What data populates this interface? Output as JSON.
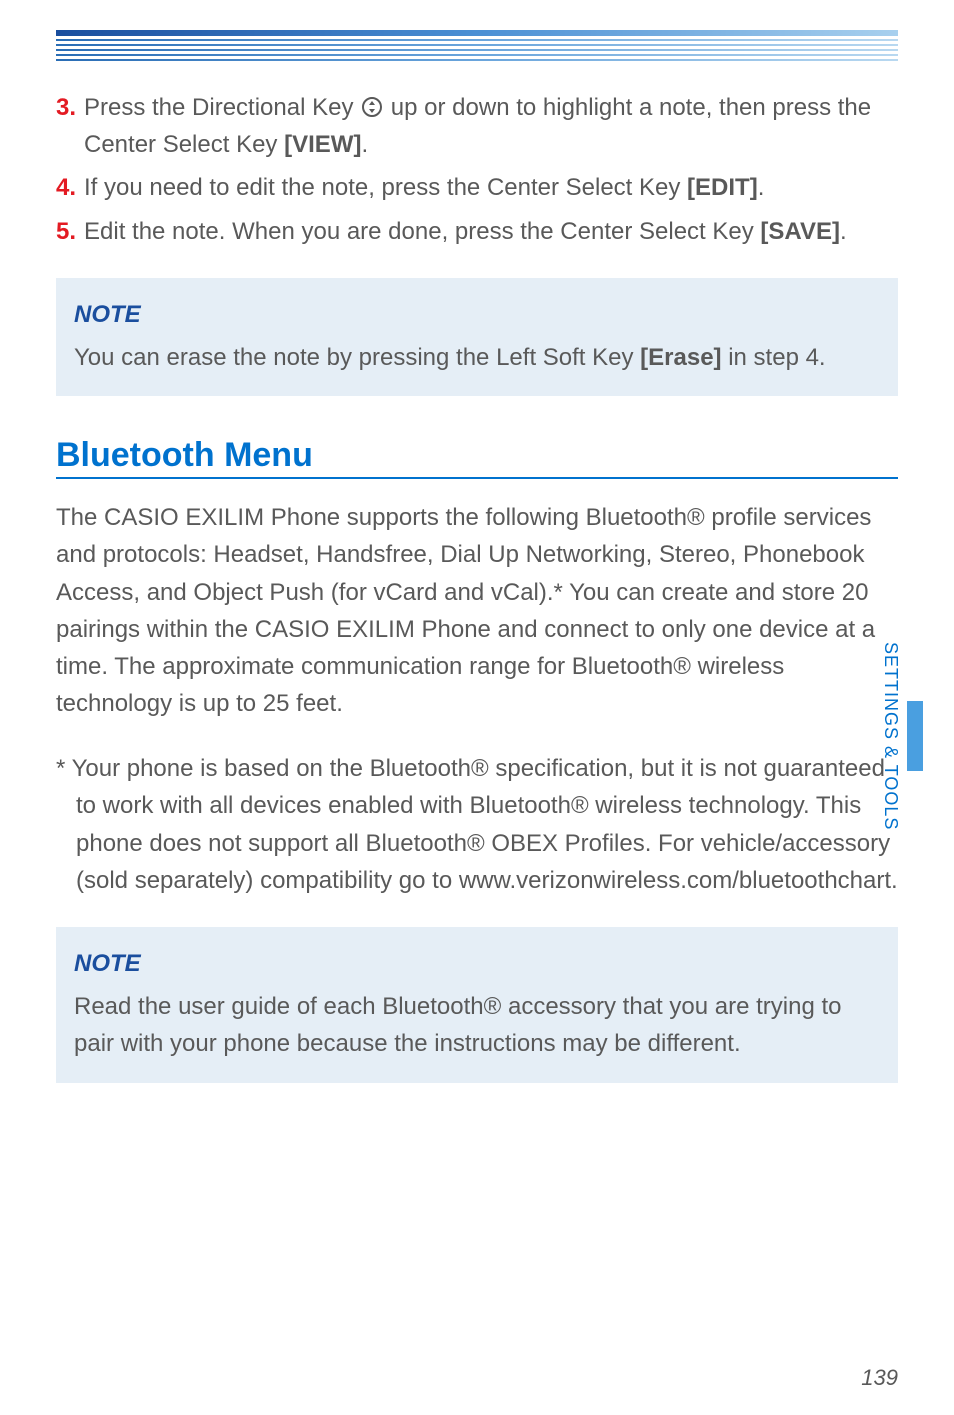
{
  "steps": [
    {
      "num": "3.",
      "pre": "Press the Directional Key ",
      "post": " up or down to highlight a note, then press the Center Select Key ",
      "key": "[VIEW]",
      "end": "."
    },
    {
      "num": "4.",
      "pre": "If you need to edit the note, press the Center Select Key ",
      "key": "[EDIT]",
      "end": "."
    },
    {
      "num": "5.",
      "pre": "Edit the note. When you are done, press the Center Select Key ",
      "key": "[SAVE]",
      "end": "."
    }
  ],
  "note1": {
    "title": "NOTE",
    "body_pre": "You can erase the note by pressing the Left Soft Key ",
    "body_key": "[Erase]",
    "body_post": " in step 4."
  },
  "heading": "Bluetooth Menu",
  "body": "The CASIO EXILIM Phone supports the following Bluetooth® profile services and protocols: Headset, Handsfree, Dial Up Networking, Stereo, Phonebook Access, and Object Push (for vCard and vCal).* You can create and store 20 pairings within the CASIO EXILIM Phone and connect to only one device at a time. The approximate communication range for Bluetooth® wireless technology is up to 25 feet.",
  "footnote": "* Your phone is based on the Bluetooth® specification, but it is not guaranteed to work with all devices enabled with Bluetooth® wireless technology. This phone does not support all Bluetooth® OBEX Profiles. For vehicle/accessory (sold separately) compatibility go to www.verizonwireless.com/bluetoothchart.",
  "note2": {
    "title": "NOTE",
    "body": "Read the user guide of each Bluetooth® accessory that you are trying to pair with your phone because the instructions may be different."
  },
  "side_label": "SETTINGS & TOOLS",
  "page_num": "139"
}
